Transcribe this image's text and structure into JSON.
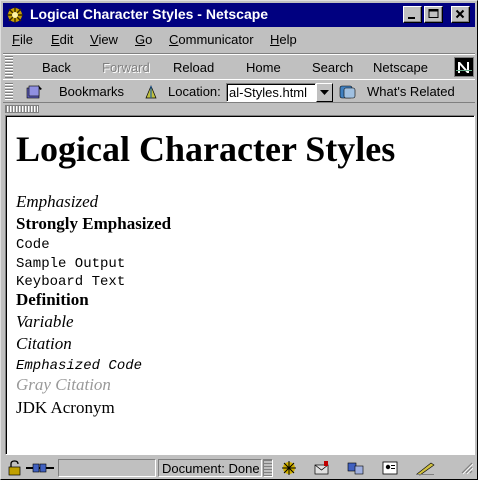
{
  "window": {
    "title": "Logical Character Styles - Netscape",
    "controls": [
      "minimize",
      "maximize",
      "close"
    ]
  },
  "menu": [
    "File",
    "Edit",
    "View",
    "Go",
    "Communicator",
    "Help"
  ],
  "menu_mnemonics": [
    "F",
    "E",
    "V",
    "G",
    "C",
    "H"
  ],
  "toolbar": {
    "buttons": [
      {
        "label": "Back",
        "enabled": true
      },
      {
        "label": "Forward",
        "enabled": false
      },
      {
        "label": "Reload",
        "enabled": true
      },
      {
        "label": "Home",
        "enabled": true
      },
      {
        "label": "Search",
        "enabled": true
      },
      {
        "label": "Netscape",
        "enabled": true
      }
    ]
  },
  "location_bar": {
    "bookmarks_label": "Bookmarks",
    "location_label": "Location:",
    "location_value": "al-Styles.html",
    "whats_related_label": "What's Related"
  },
  "content": {
    "heading": "Logical Character Styles",
    "lines": [
      {
        "text": "Emphasized",
        "style": "em"
      },
      {
        "text": "Strongly Emphasized",
        "style": "strong"
      },
      {
        "text": "Code",
        "style": "code"
      },
      {
        "text": "Sample Output",
        "style": "samp"
      },
      {
        "text": "Keyboard Text",
        "style": "kbd"
      },
      {
        "text": "Definition",
        "style": "dfn"
      },
      {
        "text": "Variable",
        "style": "var"
      },
      {
        "text": "Citation",
        "style": "cite"
      },
      {
        "text": "Emphasized Code",
        "style": "em-code"
      },
      {
        "text": "Gray Citation",
        "style": "gray-cite"
      },
      {
        "text": "JDK Acronym",
        "style": "acronym"
      }
    ]
  },
  "status": {
    "text": "Document: Done"
  },
  "colors": {
    "titlebar": "#000080",
    "chrome": "#c0c0c0",
    "gray_citation": "#999999"
  }
}
